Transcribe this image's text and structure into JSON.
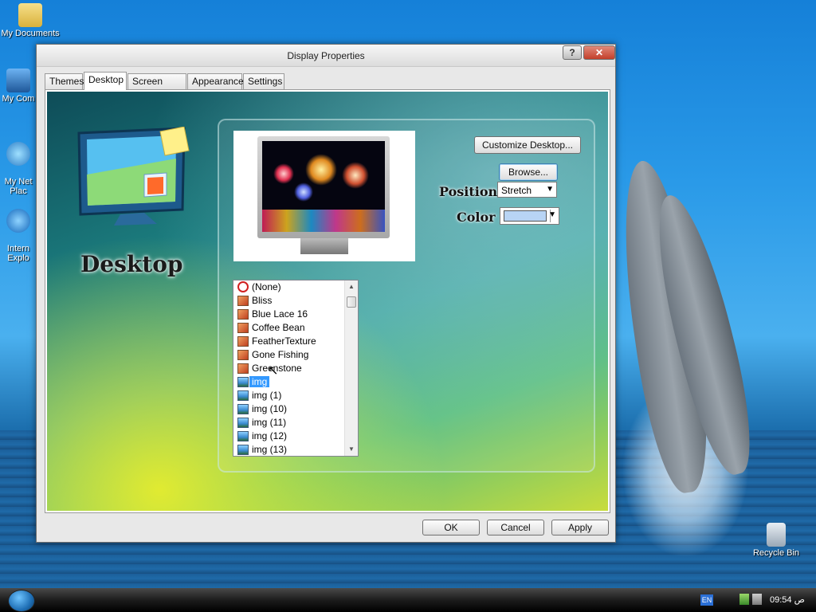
{
  "desktop": {
    "icons": [
      {
        "label": "My Documents"
      },
      {
        "label": "My Com"
      },
      {
        "label": "My Net\nPlac"
      },
      {
        "label": "Intern\nExplo"
      },
      {
        "label": "Recycle Bin"
      }
    ]
  },
  "window": {
    "title": "Display Properties",
    "help_glyph": "?",
    "close_glyph": "✕",
    "tabs": [
      {
        "label": "Themes",
        "active": false
      },
      {
        "label": "Desktop",
        "active": true
      },
      {
        "label": "Screen Saver",
        "active": false
      },
      {
        "label": "Appearance",
        "active": false
      },
      {
        "label": "Settings",
        "active": false
      }
    ],
    "panel": {
      "heading": "Desktop",
      "customize_button": "Customize Desktop...",
      "browse_button": "Browse...",
      "position_label": "Position :",
      "position_value": "Stretch",
      "color_label": "Color :",
      "color_value": "#b8d4f4",
      "backgrounds": [
        {
          "label": "(None)",
          "icon": "none-icon"
        },
        {
          "label": "Bliss",
          "icon": "image-icon"
        },
        {
          "label": "Blue Lace 16",
          "icon": "image-icon"
        },
        {
          "label": "Coffee Bean",
          "icon": "image-icon"
        },
        {
          "label": "FeatherTexture",
          "icon": "image-icon"
        },
        {
          "label": "Gone Fishing",
          "icon": "image-icon"
        },
        {
          "label": "Greenstone",
          "icon": "image-icon"
        },
        {
          "label": "img",
          "icon": "picture-icon",
          "selected": true
        },
        {
          "label": "img (1)",
          "icon": "picture-icon"
        },
        {
          "label": "img (10)",
          "icon": "picture-icon"
        },
        {
          "label": "img (11)",
          "icon": "picture-icon"
        },
        {
          "label": "img (12)",
          "icon": "picture-icon"
        },
        {
          "label": "img (13)",
          "icon": "picture-icon"
        }
      ]
    },
    "buttons": {
      "ok": "OK",
      "cancel": "Cancel",
      "apply": "Apply"
    }
  },
  "taskbar": {
    "language": "EN",
    "clock": "09:54 ص"
  },
  "colors": {
    "accent": "#3399ff",
    "close": "#c4402a"
  }
}
